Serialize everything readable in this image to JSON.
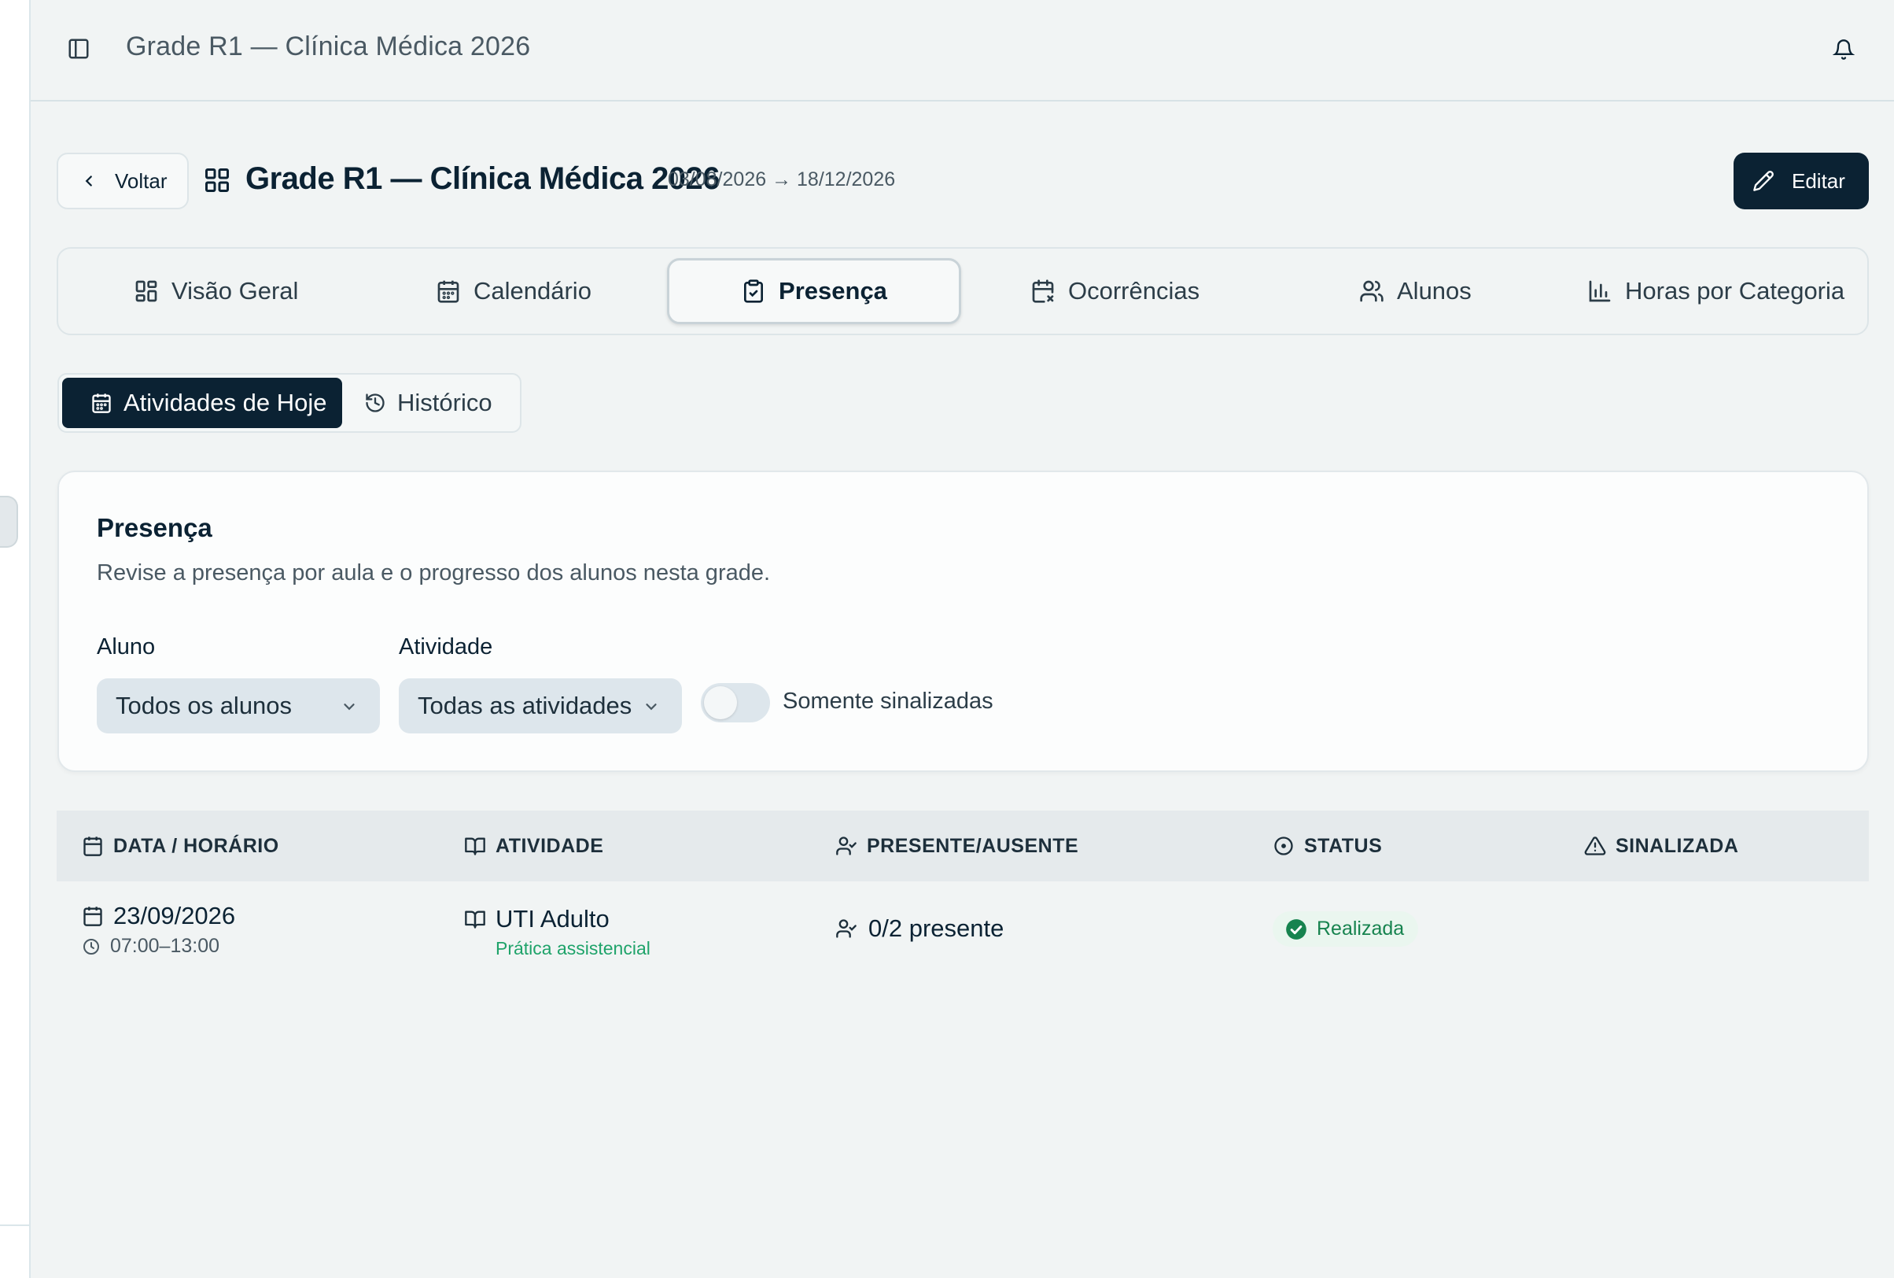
{
  "topbar": {
    "title": "Grade R1 — Clínica Médica 2026"
  },
  "header": {
    "back_label": "Voltar",
    "title": "Grade R1 — Clínica Médica 2026",
    "dates": "03/08/2026 → 18/12/2026",
    "edit_label": "Editar"
  },
  "tabs": [
    {
      "label": "Visão Geral",
      "icon": "grid-icon"
    },
    {
      "label": "Calendário",
      "icon": "calendar-icon"
    },
    {
      "label": "Presença",
      "icon": "clipboard-check-icon",
      "active": true
    },
    {
      "label": "Ocorrências",
      "icon": "calendar-x-icon"
    },
    {
      "label": "Alunos",
      "icon": "users-icon"
    },
    {
      "label": "Horas por Categoria",
      "icon": "bar-chart-icon"
    }
  ],
  "subtabs": [
    {
      "label": "Atividades de Hoje",
      "active": true
    },
    {
      "label": "Histórico"
    }
  ],
  "card": {
    "title": "Presença",
    "subtitle": "Revise a presença por aula e o progresso dos alunos nesta grade.",
    "aluno_label": "Aluno",
    "aluno_value": "Todos os alunos",
    "atividade_label": "Atividade",
    "atividade_value": "Todas as atividades",
    "toggle_label": "Somente sinalizadas",
    "toggle_on": false
  },
  "table": {
    "columns": [
      "DATA / HORÁRIO",
      "ATIVIDADE",
      "PRESENTE/AUSENTE",
      "STATUS",
      "SINALIZADA"
    ],
    "rows": [
      {
        "date": "23/09/2026",
        "time": "07:00–13:00",
        "activity": "UTI Adulto",
        "category": "Prática assistencial",
        "presence": "0/2 presente",
        "status": "Realizada",
        "flagged": ""
      }
    ]
  },
  "colors": {
    "primary": "#0b2233",
    "success": "#17834f",
    "category": "#1fa36a"
  }
}
